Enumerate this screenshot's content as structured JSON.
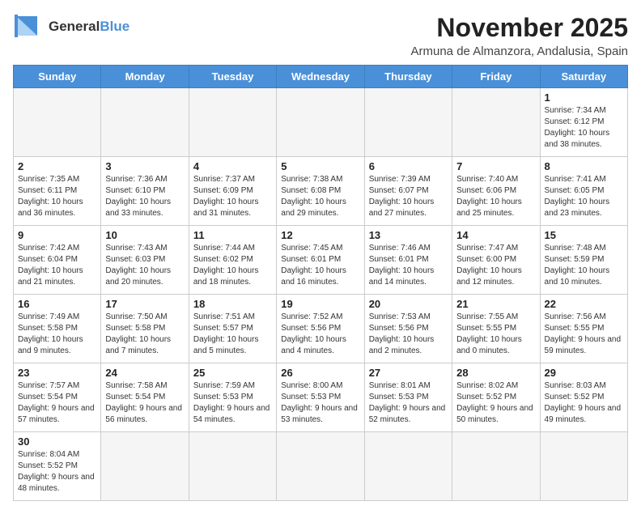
{
  "header": {
    "logo_text_general": "General",
    "logo_text_blue": "Blue",
    "title": "November 2025",
    "subtitle": "Armuna de Almanzora, Andalusia, Spain"
  },
  "days_of_week": [
    "Sunday",
    "Monday",
    "Tuesday",
    "Wednesday",
    "Thursday",
    "Friday",
    "Saturday"
  ],
  "weeks": [
    [
      {
        "day": "",
        "empty": true
      },
      {
        "day": "",
        "empty": true
      },
      {
        "day": "",
        "empty": true
      },
      {
        "day": "",
        "empty": true
      },
      {
        "day": "",
        "empty": true
      },
      {
        "day": "",
        "empty": true
      },
      {
        "day": "1",
        "sunrise": "7:34 AM",
        "sunset": "6:12 PM",
        "daylight": "10 hours and 38 minutes."
      }
    ],
    [
      {
        "day": "2",
        "sunrise": "7:35 AM",
        "sunset": "6:11 PM",
        "daylight": "10 hours and 36 minutes."
      },
      {
        "day": "3",
        "sunrise": "7:36 AM",
        "sunset": "6:10 PM",
        "daylight": "10 hours and 33 minutes."
      },
      {
        "day": "4",
        "sunrise": "7:37 AM",
        "sunset": "6:09 PM",
        "daylight": "10 hours and 31 minutes."
      },
      {
        "day": "5",
        "sunrise": "7:38 AM",
        "sunset": "6:08 PM",
        "daylight": "10 hours and 29 minutes."
      },
      {
        "day": "6",
        "sunrise": "7:39 AM",
        "sunset": "6:07 PM",
        "daylight": "10 hours and 27 minutes."
      },
      {
        "day": "7",
        "sunrise": "7:40 AM",
        "sunset": "6:06 PM",
        "daylight": "10 hours and 25 minutes."
      },
      {
        "day": "8",
        "sunrise": "7:41 AM",
        "sunset": "6:05 PM",
        "daylight": "10 hours and 23 minutes."
      }
    ],
    [
      {
        "day": "9",
        "sunrise": "7:42 AM",
        "sunset": "6:04 PM",
        "daylight": "10 hours and 21 minutes."
      },
      {
        "day": "10",
        "sunrise": "7:43 AM",
        "sunset": "6:03 PM",
        "daylight": "10 hours and 20 minutes."
      },
      {
        "day": "11",
        "sunrise": "7:44 AM",
        "sunset": "6:02 PM",
        "daylight": "10 hours and 18 minutes."
      },
      {
        "day": "12",
        "sunrise": "7:45 AM",
        "sunset": "6:01 PM",
        "daylight": "10 hours and 16 minutes."
      },
      {
        "day": "13",
        "sunrise": "7:46 AM",
        "sunset": "6:01 PM",
        "daylight": "10 hours and 14 minutes."
      },
      {
        "day": "14",
        "sunrise": "7:47 AM",
        "sunset": "6:00 PM",
        "daylight": "10 hours and 12 minutes."
      },
      {
        "day": "15",
        "sunrise": "7:48 AM",
        "sunset": "5:59 PM",
        "daylight": "10 hours and 10 minutes."
      }
    ],
    [
      {
        "day": "16",
        "sunrise": "7:49 AM",
        "sunset": "5:58 PM",
        "daylight": "10 hours and 9 minutes."
      },
      {
        "day": "17",
        "sunrise": "7:50 AM",
        "sunset": "5:58 PM",
        "daylight": "10 hours and 7 minutes."
      },
      {
        "day": "18",
        "sunrise": "7:51 AM",
        "sunset": "5:57 PM",
        "daylight": "10 hours and 5 minutes."
      },
      {
        "day": "19",
        "sunrise": "7:52 AM",
        "sunset": "5:56 PM",
        "daylight": "10 hours and 4 minutes."
      },
      {
        "day": "20",
        "sunrise": "7:53 AM",
        "sunset": "5:56 PM",
        "daylight": "10 hours and 2 minutes."
      },
      {
        "day": "21",
        "sunrise": "7:55 AM",
        "sunset": "5:55 PM",
        "daylight": "10 hours and 0 minutes."
      },
      {
        "day": "22",
        "sunrise": "7:56 AM",
        "sunset": "5:55 PM",
        "daylight": "9 hours and 59 minutes."
      }
    ],
    [
      {
        "day": "23",
        "sunrise": "7:57 AM",
        "sunset": "5:54 PM",
        "daylight": "9 hours and 57 minutes."
      },
      {
        "day": "24",
        "sunrise": "7:58 AM",
        "sunset": "5:54 PM",
        "daylight": "9 hours and 56 minutes."
      },
      {
        "day": "25",
        "sunrise": "7:59 AM",
        "sunset": "5:53 PM",
        "daylight": "9 hours and 54 minutes."
      },
      {
        "day": "26",
        "sunrise": "8:00 AM",
        "sunset": "5:53 PM",
        "daylight": "9 hours and 53 minutes."
      },
      {
        "day": "27",
        "sunrise": "8:01 AM",
        "sunset": "5:53 PM",
        "daylight": "9 hours and 52 minutes."
      },
      {
        "day": "28",
        "sunrise": "8:02 AM",
        "sunset": "5:52 PM",
        "daylight": "9 hours and 50 minutes."
      },
      {
        "day": "29",
        "sunrise": "8:03 AM",
        "sunset": "5:52 PM",
        "daylight": "9 hours and 49 minutes."
      }
    ],
    [
      {
        "day": "30",
        "sunrise": "8:04 AM",
        "sunset": "5:52 PM",
        "daylight": "9 hours and 48 minutes."
      },
      {
        "day": "",
        "empty": true
      },
      {
        "day": "",
        "empty": true
      },
      {
        "day": "",
        "empty": true
      },
      {
        "day": "",
        "empty": true
      },
      {
        "day": "",
        "empty": true
      },
      {
        "day": "",
        "empty": true
      }
    ]
  ],
  "labels": {
    "sunrise_prefix": "Sunrise: ",
    "sunset_prefix": "Sunset: ",
    "daylight_prefix": "Daylight: "
  }
}
